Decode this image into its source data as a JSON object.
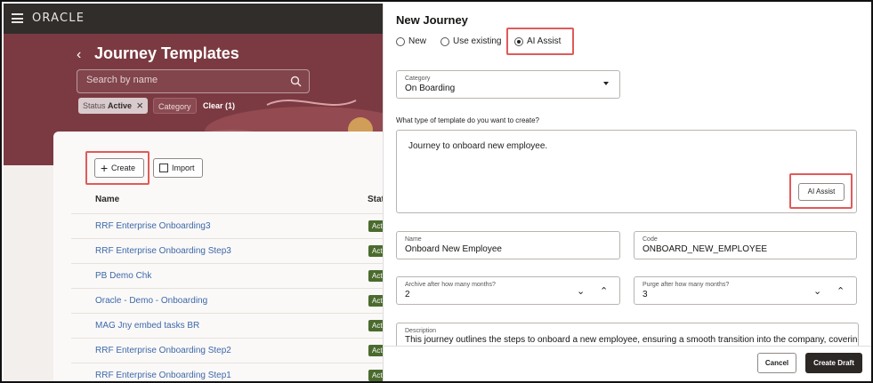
{
  "app": {
    "logo": "ORACLE",
    "page_title": "Journey Templates",
    "search": {
      "placeholder": "Search by name"
    },
    "filters": {
      "status_label": "Status",
      "status_value": "Active",
      "category_label": "Category",
      "clear_label": "Clear (1)"
    },
    "toolbar": {
      "create_label": "Create",
      "import_label": "Import"
    },
    "table": {
      "headers": [
        "Name",
        "Statu"
      ],
      "rows": [
        {
          "name": "RRF Enterprise Onboarding3",
          "status": "Act"
        },
        {
          "name": "RRF Enterprise Onboarding Step3",
          "status": "Act"
        },
        {
          "name": "PB Demo Chk",
          "status": "Act"
        },
        {
          "name": "Oracle - Demo - Onboarding",
          "status": "Act"
        },
        {
          "name": "MAG Jny embed tasks BR",
          "status": "Act"
        },
        {
          "name": "RRF Enterprise Onboarding Step2",
          "status": "Act"
        },
        {
          "name": "RRF Enterprise Onboarding Step1",
          "status": "Act"
        }
      ]
    }
  },
  "drawer": {
    "title": "New Journey",
    "options": {
      "new": "New",
      "existing": "Use existing",
      "ai": "AI Assist",
      "selected": "AI Assist"
    },
    "category": {
      "label": "Category",
      "value": "On Boarding"
    },
    "prompt": {
      "question": "What type of template do you want to create?",
      "text": "Journey to onboard new employee.",
      "button": "AI Assist"
    },
    "name": {
      "label": "Name",
      "value": "Onboard New Employee"
    },
    "code": {
      "label": "Code",
      "value": "ONBOARD_NEW_EMPLOYEE"
    },
    "archive": {
      "label": "Archive after how many months?",
      "value": "2"
    },
    "purge": {
      "label": "Purge after how many months?",
      "value": "3"
    },
    "description": {
      "label": "Description",
      "value": "This journey outlines the steps to onboard a new employee, ensuring a smooth transition into the company, covering es"
    },
    "footer": {
      "cancel": "Cancel",
      "create_draft": "Create Draft"
    }
  },
  "colors": {
    "hero": "#7b3a41",
    "highlight": "#e05a5a",
    "link": "#3c68a8",
    "badge": "#4b6b2e",
    "primary_button": "#2b2826"
  }
}
